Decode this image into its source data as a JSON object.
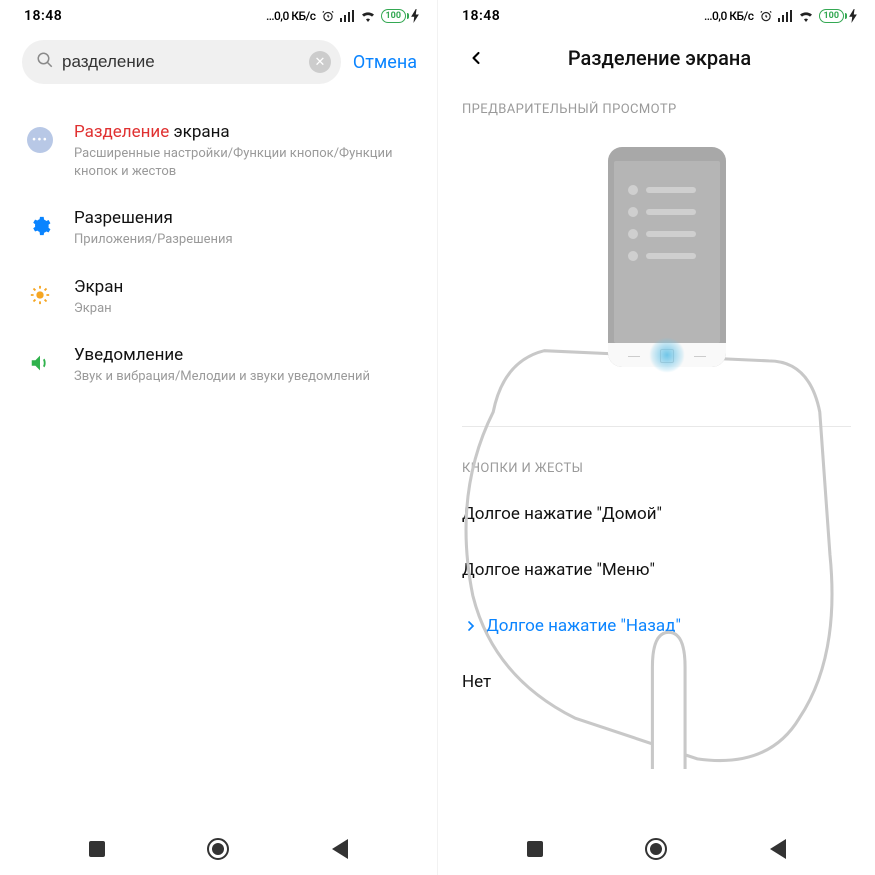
{
  "status": {
    "time": "18:48",
    "speed": "0,0 КБ/с",
    "battery": "100"
  },
  "left": {
    "search": {
      "value": "разделение",
      "placeholder": ""
    },
    "cancel": "Отмена",
    "results": [
      {
        "highlight": "Разделение",
        "rest": " экрана",
        "sub": "Расширенные настройки/Функции кнопок/Функции кнопок и жестов"
      },
      {
        "title": "Разрешения",
        "sub": "Приложения/Разрешения"
      },
      {
        "title": "Экран",
        "sub": "Экран"
      },
      {
        "title": "Уведомление",
        "sub": "Звук и вибрация/Мелодии и звуки уведомлений"
      }
    ]
  },
  "right": {
    "title": "Разделение экрана",
    "preview_label": "ПРЕДВАРИТЕЛЬНЫЙ ПРОСМОТР",
    "gestures_label": "КНОПКИ И ЖЕСТЫ",
    "options": [
      {
        "label": "Долгое нажатие \"Домой\""
      },
      {
        "label": "Долгое нажатие \"Меню\""
      },
      {
        "label": "Долгое нажатие \"Назад\""
      },
      {
        "label": "Нет"
      }
    ]
  }
}
